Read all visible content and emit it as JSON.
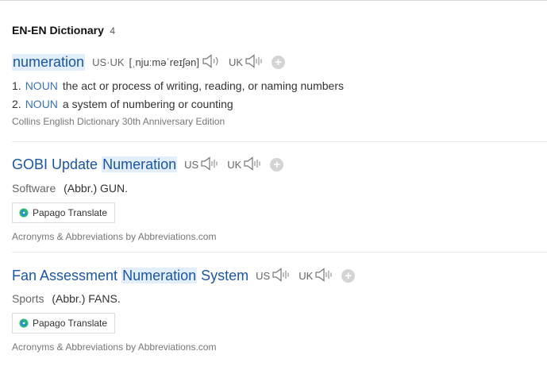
{
  "section": {
    "title": "EN-EN Dictionary",
    "count": "4"
  },
  "entry1": {
    "headword": "numeration",
    "us_uk_label": "US·UK",
    "phonetic": "[ˌnjuːməˈreɪʃən]",
    "uk_label": "UK",
    "plus": "+",
    "defs": [
      {
        "num": "1.",
        "pos": "NOUN",
        "text": "the act or process of writing, reading, or naming numbers"
      },
      {
        "num": "2.",
        "pos": "NOUN",
        "text": "a system of numbering or counting"
      }
    ],
    "source": "Collins English Dictionary 30th Anniversary Edition"
  },
  "entry2": {
    "head_pre": "GOBI Update",
    "head_hl": "Numeration",
    "us_label": "US",
    "uk_label": "UK",
    "plus": "+",
    "category": "Software",
    "meaning": "(Abbr.) GUN.",
    "translate": "Papago Translate",
    "source": "Acronyms & Abbreviations by Abbreviations.com"
  },
  "entry3": {
    "head_pre": "Fan Assessment",
    "head_hl": "Numeration",
    "head_post": "System",
    "us_label": "US",
    "uk_label": "UK",
    "plus": "+",
    "category": "Sports",
    "meaning": "(Abbr.) FANS.",
    "translate": "Papago Translate",
    "source": "Acronyms & Abbreviations by Abbreviations.com"
  },
  "icons": {
    "speaker": "speaker-icon",
    "papago": "papago-icon",
    "plus": "plus-icon"
  },
  "colors": {
    "headword": "#1b56a5",
    "highlight": "#e2eefb",
    "pos": "#3b72b5",
    "papago_green": "#2bb673",
    "papago_blue": "#1e88e5"
  }
}
